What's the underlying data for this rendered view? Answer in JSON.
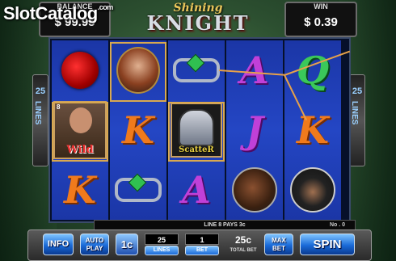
{
  "watermark": {
    "brand": "SlotCatalog",
    "suffix": ".com"
  },
  "title": {
    "top": "Shining",
    "main": "KNIGHT"
  },
  "balance": {
    "label": "BALANCE",
    "value": "$ 99.95"
  },
  "win": {
    "label": "WIN",
    "value": "$ 0.39"
  },
  "lines_indicator": {
    "number": "25",
    "label": "LINES"
  },
  "reels": [
    [
      {
        "symbol": "rose-icon"
      },
      {
        "symbol": "wild-knight",
        "badge": "8",
        "text": "Wild"
      },
      {
        "symbol": "K"
      }
    ],
    [
      {
        "symbol": "lady-portrait-icon"
      },
      {
        "symbol": "K"
      },
      {
        "symbol": "ring-icon"
      }
    ],
    [
      {
        "symbol": "ring-icon"
      },
      {
        "symbol": "scatter-helmet",
        "text": "ScatteR"
      },
      {
        "symbol": "A"
      }
    ],
    [
      {
        "symbol": "A"
      },
      {
        "symbol": "J"
      },
      {
        "symbol": "horse-icon"
      }
    ],
    [
      {
        "symbol": "Q"
      },
      {
        "symbol": "K"
      },
      {
        "symbol": "monk-icon"
      }
    ]
  ],
  "info_bar": {
    "message": "LINE  8  PAYS  3c",
    "counter": "No . 0"
  },
  "controls": {
    "info": "INFO",
    "autoplay": "AUTO PLAY",
    "coin": "1c",
    "lines_value": "25",
    "lines_label": "LINES",
    "bet_value": "1",
    "bet_label": "BET",
    "total_bet_value": "25c",
    "total_bet_label": "TOTAL BET",
    "max_bet": "MAX BET",
    "spin": "SPIN"
  },
  "colors": {
    "frame": "#3a4a6a",
    "reel": "#2446c4",
    "win_line": "#e6a14a",
    "button": "#1a6ad8"
  }
}
